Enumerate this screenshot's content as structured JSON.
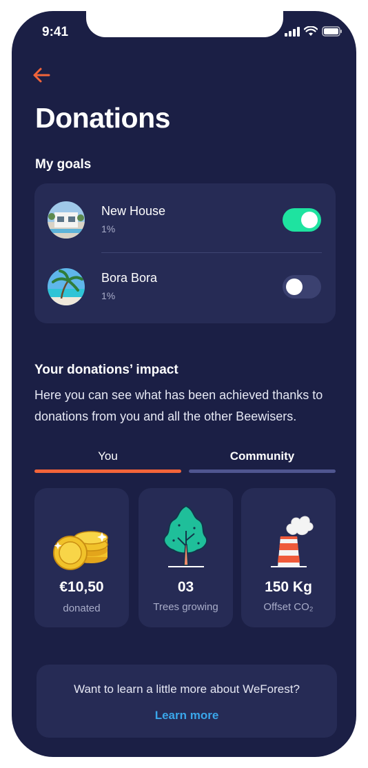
{
  "status": {
    "time": "9:41"
  },
  "header": {
    "title": "Donations"
  },
  "goals": {
    "heading": "My goals",
    "items": [
      {
        "name": "New House",
        "percent": "1%",
        "enabled": true
      },
      {
        "name": "Bora Bora",
        "percent": "1%",
        "enabled": false
      }
    ]
  },
  "impact": {
    "heading": "Your donations’ impact",
    "description": "Here you can see what has been achieved thanks to donations from you and all the other Beewisers.",
    "tabs": [
      {
        "label": "You",
        "active": false
      },
      {
        "label": "Community",
        "active": true
      }
    ],
    "stats": [
      {
        "value": "€10,50",
        "label": "donated",
        "icon": "coins-icon"
      },
      {
        "value": "03",
        "label": "Trees growing",
        "icon": "tree-icon"
      },
      {
        "value": "150 Kg",
        "label": "Offset CO₂",
        "icon": "factory-icon"
      }
    ]
  },
  "promo": {
    "text": "Want to learn a little more about WeForest?",
    "link": "Learn more"
  },
  "colors": {
    "background": "#1b1f45",
    "card": "#262b55",
    "accent": "#f2643a",
    "toggle_on": "#1ee3a0",
    "tab_inactive": "#4f558f",
    "link": "#3aa6ea"
  }
}
